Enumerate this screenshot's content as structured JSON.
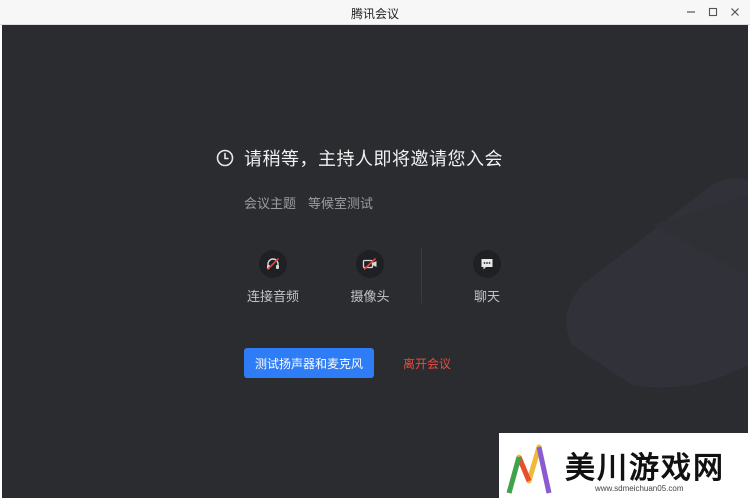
{
  "window": {
    "title": "腾讯会议",
    "controls": {
      "minimize": "–",
      "maximize": "□",
      "close": "✕"
    }
  },
  "waiting": {
    "icon": "clock-icon",
    "message": "请稍等，主持人即将邀请您入会"
  },
  "meeting": {
    "subject_label": "会议主题",
    "subject_value": "等候室测试"
  },
  "controls": [
    {
      "icon": "headset-muted-icon",
      "label": "连接音频"
    },
    {
      "icon": "camera-off-icon",
      "label": "摄像头"
    },
    {
      "icon": "chat-icon",
      "label": "聊天"
    }
  ],
  "actions": {
    "test_button": "测试扬声器和麦克风",
    "leave_link": "离开会议"
  },
  "watermark": {
    "title": "美川游戏网",
    "url": "www.sdmeichuan05.com"
  },
  "colors": {
    "background": "#2b2c30",
    "primary": "#2e7cf6",
    "danger": "#ea4b43",
    "icon_off": "#e0453c"
  }
}
